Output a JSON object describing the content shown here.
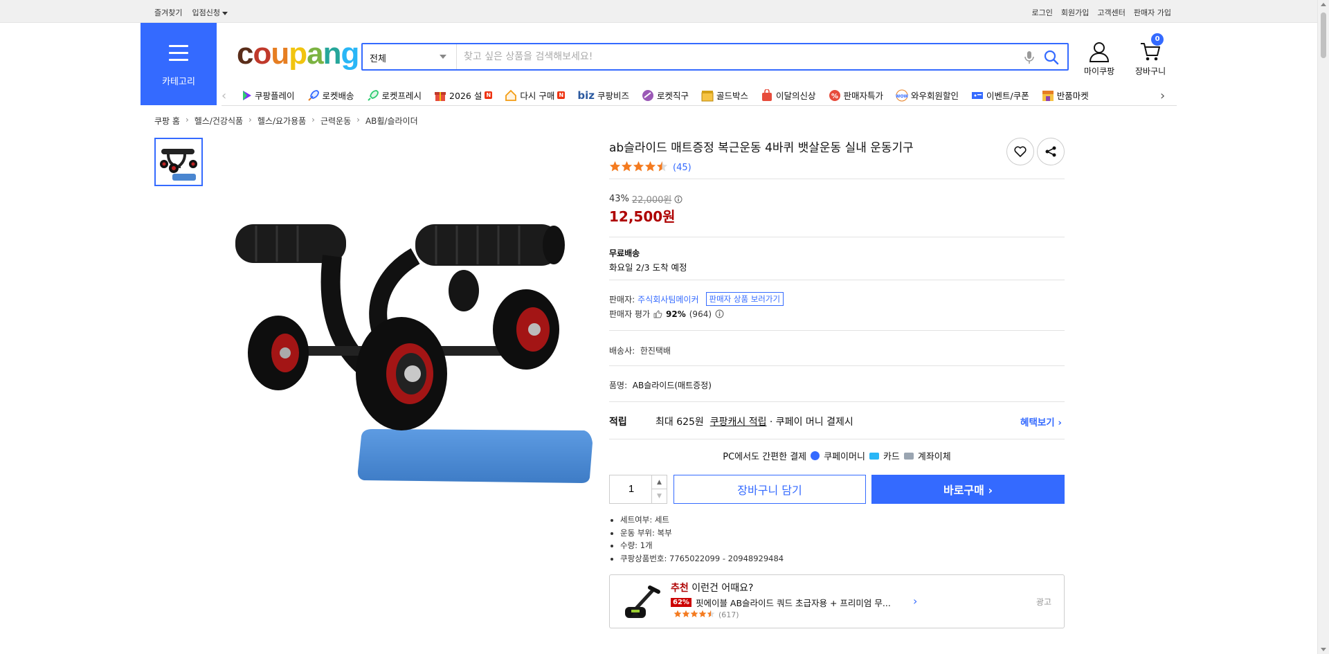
{
  "topbar": {
    "left": [
      {
        "label": "즐겨찾기"
      },
      {
        "label": "입점신청"
      }
    ],
    "right": [
      {
        "label": "로그인"
      },
      {
        "label": "회원가입"
      },
      {
        "label": "고객센터"
      },
      {
        "label": "판매자 가입"
      }
    ]
  },
  "header": {
    "category_label": "카테고리",
    "logo": {
      "c": "c",
      "o": "o",
      "u": "u",
      "p": "p",
      "a": "a",
      "n": "n",
      "g": "g"
    },
    "search": {
      "scope": "전체",
      "placeholder": "찾고 싶은 상품을 검색해보세요!"
    },
    "mypage_label": "마이쿠팡",
    "cart_label": "장바구니",
    "cart_count": "0",
    "accent": "#346aff"
  },
  "nav": {
    "items": [
      {
        "label": "쿠팡플레이",
        "icon": "play-icon",
        "color": "#7b2ff7"
      },
      {
        "label": "로켓배송",
        "icon": "rocket-icon",
        "color": "#346aff"
      },
      {
        "label": "로켓프레시",
        "icon": "rocket-fresh-icon",
        "color": "#2ecc71"
      },
      {
        "label": "2026 설",
        "icon": "gift-icon",
        "color": "#e74c3c",
        "badge": "N"
      },
      {
        "label": "다시 구매",
        "icon": "home-icon",
        "color": "#f39c12",
        "badge": "N"
      },
      {
        "label": "쿠팡비즈",
        "prefix": "biz",
        "icon": "biz-icon",
        "color": "#2c5aa0"
      },
      {
        "label": "로켓직구",
        "icon": "globe-icon",
        "color": "#9b59b6"
      },
      {
        "label": "골드박스",
        "icon": "goldbox-icon",
        "color": "#d4a017"
      },
      {
        "label": "이달의신상",
        "icon": "new-icon",
        "color": "#e74c3c"
      },
      {
        "label": "판매자특가",
        "icon": "percent-icon",
        "color": "#e74c3c"
      },
      {
        "label": "와우회원할인",
        "icon": "wow-icon",
        "color": "#e67e22"
      },
      {
        "label": "이벤트/쿠폰",
        "icon": "coupon-icon",
        "color": "#346aff"
      },
      {
        "label": "반품마켓",
        "icon": "market-icon",
        "color": "#e67e22"
      }
    ]
  },
  "breadcrumb": [
    "쿠팡 홈",
    "헬스/건강식품",
    "헬스/요가용품",
    "근력운동",
    "AB휠/슬라이더"
  ],
  "product": {
    "title": "ab슬라이드 매트증정 복근운동 4바퀴 뱃살운동 실내 운동기구",
    "rating": 4.5,
    "review_count": "(45)",
    "discount_rate": "43%",
    "original_price": "22,000원",
    "price": "12,500원",
    "shipping": "무료배송",
    "arrival": "화요일 2/3 도착 예정",
    "seller_label": "판매자:",
    "seller_name": "주식회사팀메이커",
    "seller_link": "판매자 상품 보러가기",
    "seller_rating_label": "판매자 평가",
    "seller_rating_pct": "92%",
    "seller_rating_count": "(964)",
    "carrier_label": "배송사:",
    "carrier": "한진택배",
    "name_label": "품명:",
    "name_value": "AB슬라이드(매트증정)",
    "reward_label": "적립",
    "reward_max": "최대 625원",
    "reward_cash": "쿠팡캐시 적립",
    "reward_tail": "· 쿠페이 머니 결제시",
    "reward_more": "혜택보기",
    "pay_intro": "PC에서도 간편한 결제",
    "pay_methods": [
      {
        "label": "쿠페이머니",
        "color": "#346aff"
      },
      {
        "label": "카드",
        "color": "#29b6f6"
      },
      {
        "label": "계좌이체",
        "color": "#9aa5b1"
      }
    ],
    "quantity": "1",
    "cart_button": "장바구니 담기",
    "buy_button": "바로구매",
    "specs": [
      "세트여부: 세트",
      "운동 부위: 복부",
      "수량: 1개",
      "쿠팡상품번호: 7765022099 - 20948929484"
    ]
  },
  "recommend": {
    "prefix": "추천",
    "title": "이런건 어때요?",
    "discount": "62%",
    "item": "핏에이블 AB슬라이드 쿼드 초급자용 + 프리미엄 무...",
    "rating": 4.5,
    "count": "(617)",
    "ad_label": "광고"
  }
}
